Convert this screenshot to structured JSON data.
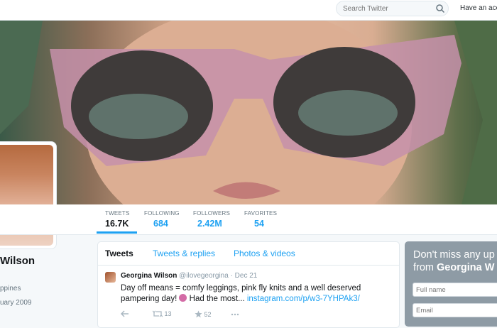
{
  "topbar": {
    "search_placeholder": "Search Twitter",
    "account_link": "Have an acco"
  },
  "stats": [
    {
      "label": "TWEETS",
      "value": "16.7K"
    },
    {
      "label": "FOLLOWING",
      "value": "684"
    },
    {
      "label": "FOLLOWERS",
      "value": "2.42M"
    },
    {
      "label": "FAVORITES",
      "value": "54"
    }
  ],
  "profile": {
    "name": "Wilson",
    "location": "ppines",
    "joined": "uary 2009"
  },
  "timeline": {
    "tabs": [
      "Tweets",
      "Tweets & replies",
      "Photos & videos"
    ],
    "tweet": {
      "name": "Georgina Wilson",
      "handle": "@ilovegeorgina",
      "date": "· Dec 21",
      "text_line1": "Day off means = comfy leggings, pink fly knits and a well deserved",
      "text_line2": "pampering day!",
      "text_after_emoji": " Had the most... ",
      "link": "instagram.com/p/w3-7YHPAk3/",
      "retweets": "13",
      "favorites": "52"
    }
  },
  "signup": {
    "title_line1": "Don't miss any up",
    "title_from": "from ",
    "title_name": "Georgina W",
    "fullname_placeholder": "Full name",
    "email_placeholder": "Email"
  },
  "colors": {
    "accent": "#1da1f2",
    "page_bg": "#f5f8fa",
    "signup_bg": "#8e9ba5"
  }
}
